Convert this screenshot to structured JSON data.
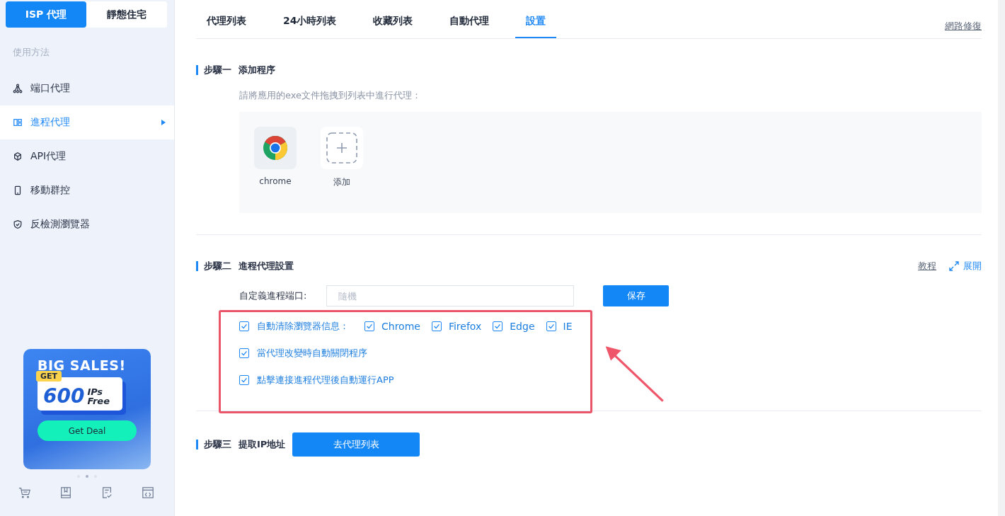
{
  "sidebar": {
    "tabs": [
      {
        "label": "ISP 代理",
        "selected": true
      },
      {
        "label": "靜態住宅",
        "selected": false
      }
    ],
    "section_label": "使用方法",
    "items": [
      {
        "label": "端口代理",
        "selected": false
      },
      {
        "label": "進程代理",
        "selected": true
      },
      {
        "label": "API代理",
        "selected": false
      },
      {
        "label": "移動群控",
        "selected": false
      },
      {
        "label": "反檢測瀏覽器",
        "selected": false
      }
    ],
    "promo": {
      "headline": "BIG SALES!",
      "badge": "GET",
      "amount": "600",
      "unit_line1": "IPs",
      "unit_line2": "Free",
      "button": "Get Deal"
    },
    "carousel_dots": [
      {
        "selected": false
      },
      {
        "selected": true
      },
      {
        "selected": false
      }
    ]
  },
  "tabs": [
    {
      "label": "代理列表",
      "selected": false
    },
    {
      "label": "24小時列表",
      "selected": false
    },
    {
      "label": "收藏列表",
      "selected": false
    },
    {
      "label": "自動代理",
      "selected": false
    },
    {
      "label": "設置",
      "selected": true
    }
  ],
  "repair_link": "網路修復",
  "step1": {
    "label": "步驟一",
    "title": "添加程序",
    "hint": "請將應用的exe文件拖拽到列表中進行代理：",
    "apps": [
      {
        "kind": "app",
        "name": "chrome"
      },
      {
        "kind": "add",
        "name": "添加"
      }
    ]
  },
  "step2": {
    "label": "步驟二",
    "title": "進程代理設置",
    "tutorial_link": "教程",
    "expand_link": "展開",
    "port_label": "自定義進程端口:",
    "port_placeholder": "隨機",
    "save_button": "保存",
    "options": [
      {
        "label": "自動清除瀏覽器信息：",
        "checked": true,
        "browsers": [
          {
            "label": "Chrome",
            "checked": true
          },
          {
            "label": "Firefox",
            "checked": true
          },
          {
            "label": "Edge",
            "checked": true
          },
          {
            "label": "IE",
            "checked": true
          }
        ]
      },
      {
        "label": "當代理改變時自動關閉程序",
        "checked": true
      },
      {
        "label": "點擊連接進程代理後自動運行APP",
        "checked": true
      }
    ]
  },
  "step3": {
    "label": "步驟三",
    "title": "提取IP地址",
    "button": "去代理列表"
  }
}
